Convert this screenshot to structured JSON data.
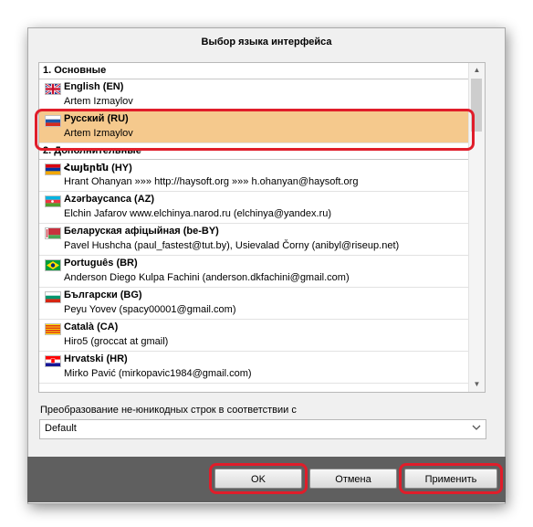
{
  "dialog": {
    "title": "Выбор языка интерфейса"
  },
  "groups": [
    {
      "label": "1. Основные"
    },
    {
      "label": "2. Дополнительные"
    }
  ],
  "languages": [
    {
      "name": "English (EN)",
      "author": "Artem Izmaylov",
      "flag": "uk-flag-icon"
    },
    {
      "name": "Русский (RU)",
      "author": "Artem Izmaylov",
      "flag": "russia-flag-icon",
      "selected": true
    },
    {
      "name": "Հայերեն (HY)",
      "author": "Hrant Ohanyan »»» http://haysoft.org »»» h.ohanyan@haysoft.org",
      "flag": "armenia-flag-icon"
    },
    {
      "name": "Azərbaycanca (AZ)",
      "author": "Elchin Jafarov www.elchinya.narod.ru (elchinya@yandex.ru)",
      "flag": "azerbaijan-flag-icon"
    },
    {
      "name": "Беларуская афіцыйная (be-BY)",
      "author": "Pavel Hushcha (paul_fastest@tut.by), Usievalad Čorny (anibyl@riseup.net)",
      "flag": "belarus-flag-icon"
    },
    {
      "name": "Português (BR)",
      "author": "Anderson Diego Kulpa Fachini (anderson.dkfachini@gmail.com)",
      "flag": "brazil-flag-icon"
    },
    {
      "name": "Български (BG)",
      "author": "Peyu Yovev (spacy00001@gmail.com)",
      "flag": "bulgaria-flag-icon"
    },
    {
      "name": "Català (CA)",
      "author": "Hiro5 (groccat at gmail)",
      "flag": "catalonia-flag-icon"
    },
    {
      "name": "Hrvatski (HR)",
      "author": "Mirko Pavić (mirkopavic1984@gmail.com)",
      "flag": "croatia-flag-icon"
    }
  ],
  "encoding": {
    "label": "Преобразование не-юникодных строк в соответствии с",
    "value": "Default"
  },
  "buttons": {
    "ok": "OK",
    "cancel": "Отмена",
    "apply": "Применить"
  },
  "colors": {
    "selection": "#f5c98d",
    "highlight_ring": "#e01d2a",
    "footer": "#5f5f5f"
  }
}
